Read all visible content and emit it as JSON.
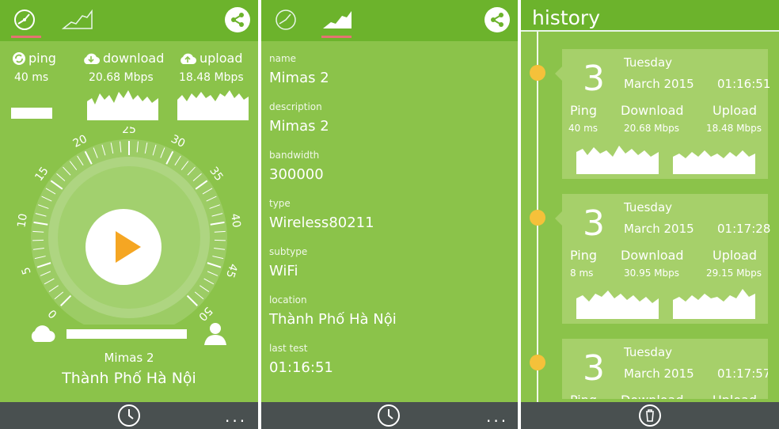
{
  "speed": {
    "stats": {
      "ping": {
        "label": "ping",
        "value": "40 ms"
      },
      "download": {
        "label": "download",
        "value": "20.68 Mbps"
      },
      "upload": {
        "label": "upload",
        "value": "18.48 Mbps"
      }
    },
    "gauge": {
      "ticks": [
        "0",
        "5",
        "10",
        "15",
        "20",
        "25",
        "30",
        "35",
        "40",
        "45",
        "50"
      ]
    },
    "server": {
      "name": "Mimas 2",
      "location": "Thành Phố Hà Nội"
    },
    "menu_dots": "..."
  },
  "details": {
    "fields": [
      {
        "label": "name",
        "value": "Mimas 2"
      },
      {
        "label": "description",
        "value": "Mimas 2"
      },
      {
        "label": "bandwidth",
        "value": "300000"
      },
      {
        "label": "type",
        "value": "Wireless80211"
      },
      {
        "label": "subtype",
        "value": "WiFi"
      },
      {
        "label": "location",
        "value": "Thành Phố Hà Nội"
      },
      {
        "label": "last test",
        "value": "01:16:51"
      }
    ],
    "menu_dots": "..."
  },
  "history": {
    "title": "history",
    "entries": [
      {
        "day": "3",
        "weekday": "Tuesday",
        "date": "March 2015",
        "time": "01:16:51",
        "ping_label": "Ping",
        "download_label": "Download",
        "upload_label": "Upload",
        "ping": "40 ms",
        "download": "20.68 Mbps",
        "upload": "18.48 Mbps"
      },
      {
        "day": "3",
        "weekday": "Tuesday",
        "date": "March 2015",
        "time": "01:17:28",
        "ping_label": "Ping",
        "download_label": "Download",
        "upload_label": "Upload",
        "ping": "8 ms",
        "download": "30.95 Mbps",
        "upload": "29.15 Mbps"
      },
      {
        "day": "3",
        "weekday": "Tuesday",
        "date": "March 2015",
        "time": "01:17:57",
        "ping_label": "Ping",
        "download_label": "Download",
        "upload_label": "Upload",
        "ping": "",
        "download": "",
        "upload": ""
      }
    ]
  },
  "colors": {
    "panel": "#8bc34a",
    "bar": "#6cb32c",
    "bottom": "#495050",
    "accent_tab": "#e57373",
    "play": "#f5a623",
    "dot": "#f5c13a"
  },
  "icons": [
    "speedometer-icon",
    "chart-icon",
    "share-icon",
    "clock-icon",
    "cloud-download-icon",
    "cloud-upload-icon",
    "refresh-icon",
    "play-icon",
    "cloud-icon",
    "user-icon",
    "trash-icon"
  ]
}
